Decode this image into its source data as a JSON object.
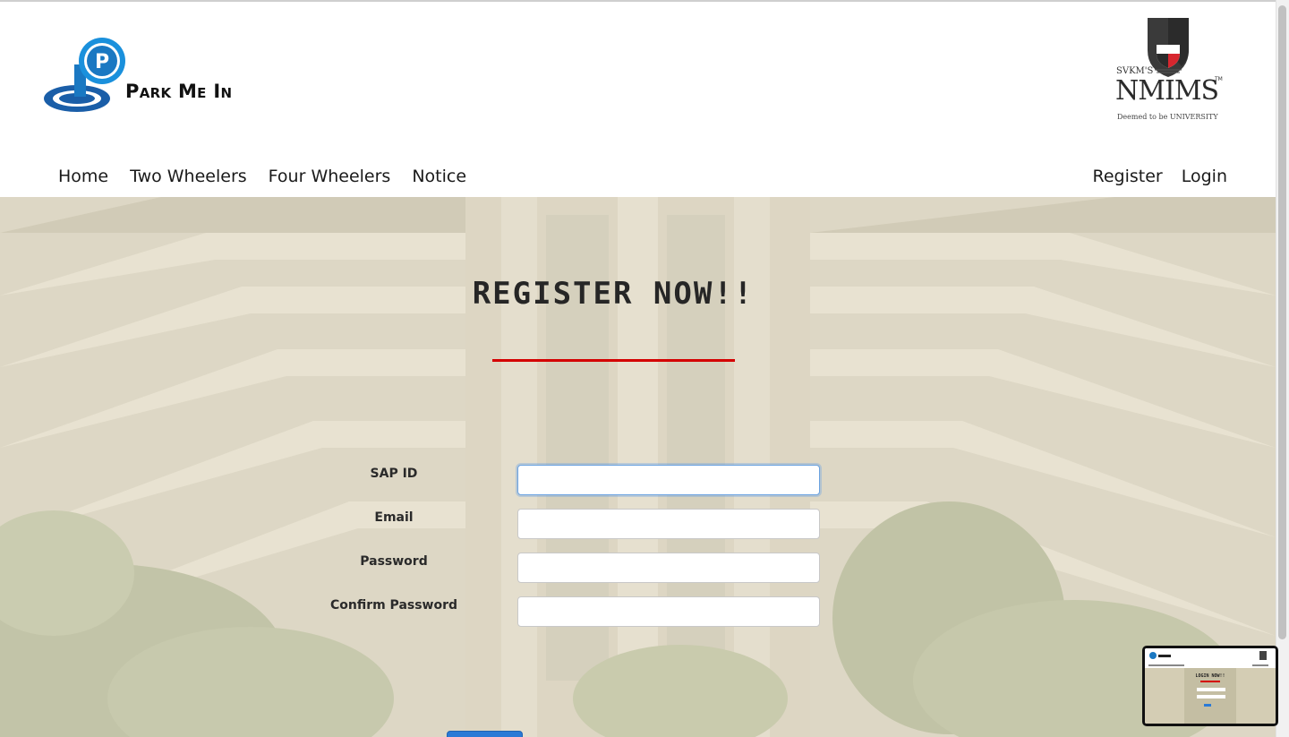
{
  "brand": {
    "name": "Park Me In",
    "logo_letter": "P"
  },
  "university": {
    "prefix": "SVKM'S",
    "name": "NMIMS",
    "trademark": "TM",
    "subtitle": "Deemed to be UNIVERSITY"
  },
  "nav": {
    "left": [
      "Home",
      "Two Wheelers",
      "Four Wheelers",
      "Notice"
    ],
    "right": [
      "Register",
      "Login"
    ]
  },
  "form": {
    "title": "REGISTER NOW!!",
    "fields": [
      {
        "label": "SAP ID",
        "value": "",
        "type": "text"
      },
      {
        "label": "Email",
        "value": "",
        "type": "email"
      },
      {
        "label": "Password",
        "value": "",
        "type": "password"
      },
      {
        "label": "Confirm Password",
        "value": "",
        "type": "password"
      }
    ],
    "submit_label": ""
  },
  "thumbnail": {
    "title": "LOGIN NOW!!"
  },
  "colors": {
    "accent": "#d40000",
    "brand_blue": "#1a78c2",
    "button": "#2a7ad6"
  }
}
